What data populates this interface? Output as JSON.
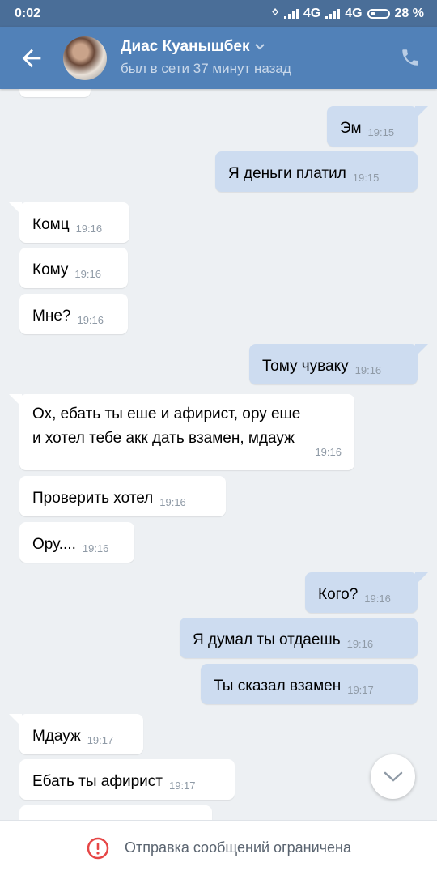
{
  "status": {
    "time": "0:02",
    "net1": "4G",
    "net2": "4G",
    "battery": "28 %"
  },
  "header": {
    "name": "Диас Куанышбек",
    "last_seen": "был в сети 37 минут назад"
  },
  "messages": [
    {
      "dir": "out",
      "text": "Эм",
      "time": "19:15"
    },
    {
      "dir": "out",
      "text": "Я деньги платил",
      "time": "19:15"
    },
    {
      "dir": "in",
      "text": "Комц",
      "time": "19:16"
    },
    {
      "dir": "in",
      "text": "Кому",
      "time": "19:16"
    },
    {
      "dir": "in",
      "text": "Мне?",
      "time": "19:16"
    },
    {
      "dir": "out",
      "text": "Тому чуваку",
      "time": "19:16"
    },
    {
      "dir": "in",
      "line1": "Ох, ебать ты еше и афирист, ору еше",
      "line2": "и хотел тебе акк дать взамен, мдауж",
      "time": "19:16"
    },
    {
      "dir": "in",
      "text": "Проверить хотел",
      "time": "19:16"
    },
    {
      "dir": "in",
      "text": "Ору....",
      "time": "19:16"
    },
    {
      "dir": "out",
      "text": "Кого?",
      "time": "19:16"
    },
    {
      "dir": "out",
      "text": "Я думал ты отдаешь",
      "time": "19:16"
    },
    {
      "dir": "out",
      "text": "Ты сказал взамен",
      "time": "19:17"
    },
    {
      "dir": "in",
      "text": "Мдауж",
      "time": "19:17"
    },
    {
      "dir": "in",
      "text": "Ебать ты афирист",
      "time": "19:17"
    }
  ],
  "footer": {
    "notice": "Отправка сообщений ограничена"
  },
  "icons": {
    "back": "arrow-left-icon",
    "call": "phone-icon",
    "scroll": "chevron-down-icon",
    "warning": "exclamation-circle-icon"
  },
  "colors": {
    "header": "#5181b8",
    "outgoing": "#cddcf0",
    "incoming": "#ffffff",
    "warning": "#e64646"
  }
}
